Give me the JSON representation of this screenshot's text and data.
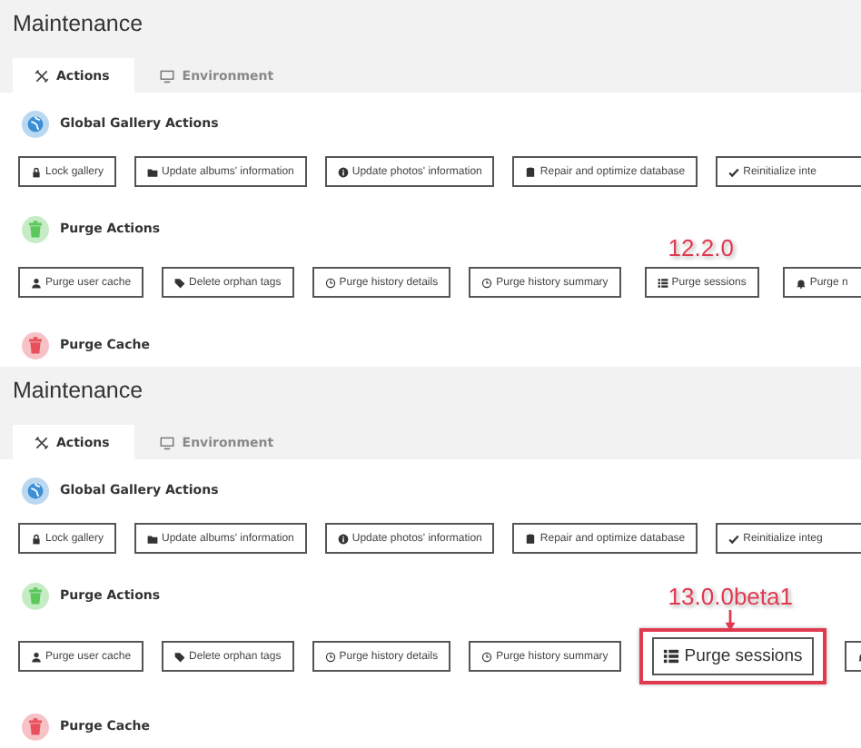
{
  "panels": [
    {
      "title": "Maintenance",
      "tabs": [
        {
          "label": "Actions",
          "kind": "tools",
          "selected": true
        },
        {
          "label": "Environment",
          "kind": "monitor",
          "selected": false
        }
      ],
      "sections": [
        {
          "title": "Global Gallery Actions",
          "kind": "globe",
          "color": "#3b8fd6",
          "buttons": [
            {
              "label": "Lock gallery",
              "kind": "lock"
            },
            {
              "label": "Update albums' information",
              "kind": "folder"
            },
            {
              "label": "Update photos' information",
              "kind": "info"
            },
            {
              "label": "Repair and optimize database",
              "kind": "database"
            },
            {
              "label": "Reinitialize inte",
              "kind": "check"
            }
          ]
        },
        {
          "title": "Purge Actions",
          "kind": "trash",
          "color": "#5cc85c",
          "buttons": [
            {
              "label": "Purge user cache",
              "kind": "user"
            },
            {
              "label": "Delete orphan tags",
              "kind": "tag"
            },
            {
              "label": "Purge history details",
              "kind": "history"
            },
            {
              "label": "Purge history summary",
              "kind": "history"
            },
            {
              "label": "Purge sessions",
              "kind": "list",
              "annotation": "12.2.0",
              "highlighted": false
            },
            {
              "label": "Purge n",
              "kind": "bell"
            }
          ]
        },
        {
          "title": "Purge Cache",
          "kind": "trash",
          "color": "#e8505b"
        }
      ]
    },
    {
      "title": "Maintenance",
      "tabs": [
        {
          "label": "Actions",
          "kind": "tools",
          "selected": true
        },
        {
          "label": "Environment",
          "kind": "monitor",
          "selected": false
        }
      ],
      "sections": [
        {
          "title": "Global Gallery Actions",
          "kind": "globe",
          "color": "#3b8fd6",
          "buttons": [
            {
              "label": "Lock gallery",
              "kind": "lock"
            },
            {
              "label": "Update albums' information",
              "kind": "folder"
            },
            {
              "label": "Update photos' information",
              "kind": "info"
            },
            {
              "label": "Repair and optimize database",
              "kind": "database"
            },
            {
              "label": "Reinitialize integ",
              "kind": "check"
            }
          ]
        },
        {
          "title": "Purge Actions",
          "kind": "trash",
          "color": "#5cc85c",
          "buttons": [
            {
              "label": "Purge user cache",
              "kind": "user"
            },
            {
              "label": "Delete orphan tags",
              "kind": "tag"
            },
            {
              "label": "Purge history details",
              "kind": "history"
            },
            {
              "label": "Purge history summary",
              "kind": "history"
            },
            {
              "label": "Purge sessions",
              "kind": "list",
              "annotation": "13.0.0beta1",
              "highlighted": true
            },
            {
              "kind": "bell"
            }
          ]
        },
        {
          "title": "Purge Cache",
          "kind": "trash",
          "color": "#e8505b"
        }
      ]
    }
  ]
}
